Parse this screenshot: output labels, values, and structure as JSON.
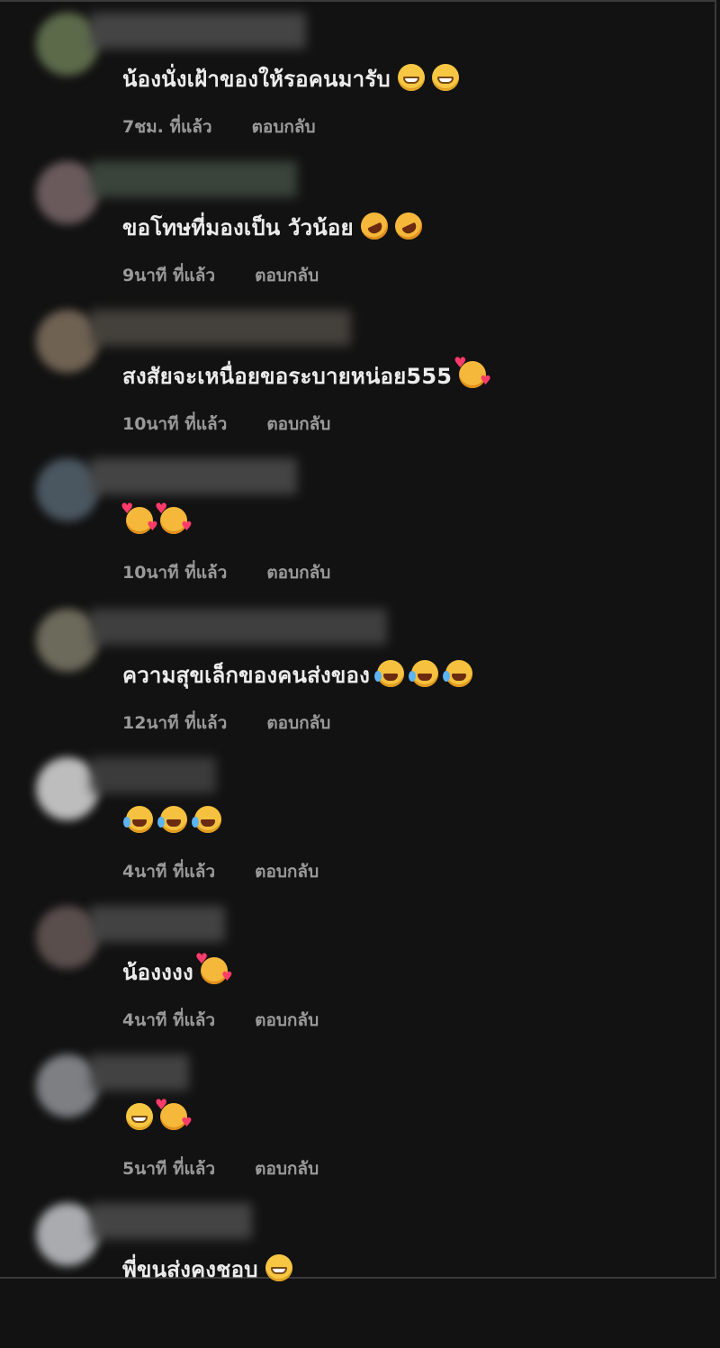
{
  "comments": [
    {
      "text": "น้องนั่งเฝ้าของให้รอคนมารับ",
      "emojis": [
        "grin",
        "grin"
      ],
      "time": "7ชม. ที่แล้ว",
      "reply": "ตอบกลับ",
      "avatar_color": "#5d6a4a",
      "name_color": "#4a4a4a"
    },
    {
      "text": "ขอโทษที่มองเป็น วัวน้อย",
      "emojis": [
        "rofl",
        "rofl"
      ],
      "time": "9นาที ที่แล้ว",
      "reply": "ตอบกลับ",
      "avatar_color": "#6a5a5c",
      "name_color": "#3f4a3f"
    },
    {
      "text": "สงสัยจะเหนื่อยขอระบายหน่อย555",
      "emojis": [
        "love"
      ],
      "time": "10นาที ที่แล้ว",
      "reply": "ตอบกลับ",
      "avatar_color": "#6f6253",
      "name_color": "#4a4640"
    },
    {
      "text": "",
      "emojis": [
        "love",
        "love"
      ],
      "time": "10นาที ที่แล้ว",
      "reply": "ตอบกลับ",
      "avatar_color": "#4a5660",
      "name_color": "#4a4a4a"
    },
    {
      "text": "ความสุขเล็กของคนส่งของ",
      "emojis": [
        "joy",
        "joy",
        "joy"
      ],
      "time": "12นาที ที่แล้ว",
      "reply": "ตอบกลับ",
      "avatar_color": "#6c6a5a",
      "name_color": "#444"
    },
    {
      "text": "",
      "emojis": [
        "joy",
        "joy",
        "joy"
      ],
      "time": "4นาที ที่แล้ว",
      "reply": "ตอบกลับ",
      "avatar_color": "#bdbdbd",
      "name_color": "#404040"
    },
    {
      "text": "น้องงงง",
      "emojis": [
        "love"
      ],
      "time": "4นาที ที่แล้ว",
      "reply": "ตอบกลับ",
      "avatar_color": "#5a4e4c",
      "name_color": "#484848"
    },
    {
      "text": "",
      "emojis": [
        "grin",
        "love"
      ],
      "time": "5นาที ที่แล้ว",
      "reply": "ตอบกลับ",
      "avatar_color": "#7d7f83",
      "name_color": "#484848"
    },
    {
      "text": "พี่ขนส่งคงชอบ",
      "emojis": [
        "grin"
      ],
      "time": "",
      "reply": "",
      "avatar_color": "#a9abae",
      "name_color": "#4a4a4a"
    }
  ]
}
